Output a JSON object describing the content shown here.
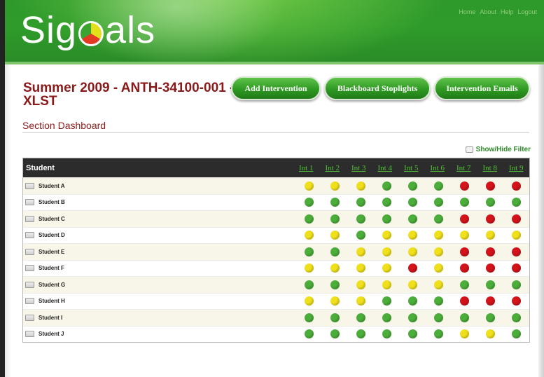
{
  "header": {
    "logo_text_before": "Sig",
    "logo_text_after": "als",
    "nav": [
      "Home",
      "About",
      "Help",
      "Logout"
    ]
  },
  "course": {
    "title": "Summer 2009 - ANTH-34100-001 - XLST",
    "section_title": "Section Dashboard"
  },
  "actions": [
    "Add Intervention",
    "Blackboard Stoplights",
    "Intervention Emails"
  ],
  "filter_toggle": "Show/Hide Filter",
  "table": {
    "student_header": "Student",
    "interventions": [
      "Int 1",
      "Int 2",
      "Int 3",
      "Int 4",
      "Int 5",
      "Int 6",
      "Int 7",
      "Int 8",
      "Int 9"
    ],
    "rows": [
      {
        "name": "Student A",
        "signals": [
          "yellow",
          "yellow",
          "yellow",
          "green",
          "green",
          "green",
          "red",
          "red",
          "red"
        ]
      },
      {
        "name": "Student B",
        "signals": [
          "green",
          "green",
          "green",
          "green",
          "green",
          "green",
          "green",
          "green",
          "green"
        ]
      },
      {
        "name": "Student C",
        "signals": [
          "green",
          "green",
          "green",
          "green",
          "green",
          "green",
          "red",
          "red",
          "red"
        ]
      },
      {
        "name": "Student D",
        "signals": [
          "yellow",
          "yellow",
          "green",
          "yellow",
          "yellow",
          "yellow",
          "yellow",
          "yellow",
          "yellow"
        ]
      },
      {
        "name": "Student E",
        "signals": [
          "green",
          "green",
          "yellow",
          "yellow",
          "yellow",
          "yellow",
          "red",
          "red",
          "red"
        ]
      },
      {
        "name": "Student F",
        "signals": [
          "yellow",
          "yellow",
          "yellow",
          "yellow",
          "red",
          "yellow",
          "red",
          "red",
          "red"
        ]
      },
      {
        "name": "Student G",
        "signals": [
          "green",
          "green",
          "yellow",
          "yellow",
          "yellow",
          "yellow",
          "green",
          "green",
          "green"
        ]
      },
      {
        "name": "Student H",
        "signals": [
          "yellow",
          "yellow",
          "yellow",
          "green",
          "green",
          "green",
          "red",
          "red",
          "red"
        ]
      },
      {
        "name": "Student I",
        "signals": [
          "green",
          "green",
          "green",
          "green",
          "green",
          "green",
          "green",
          "green",
          "green"
        ]
      },
      {
        "name": "Student J",
        "signals": [
          "green",
          "green",
          "green",
          "green",
          "green",
          "green",
          "yellow",
          "yellow",
          "green"
        ]
      }
    ]
  },
  "colors": {
    "brand_green": "#2e9b2a",
    "title_red": "#8a1a1a",
    "signal_green": "#4cae3a",
    "signal_yellow": "#f0e01c",
    "signal_red": "#d4131b"
  }
}
